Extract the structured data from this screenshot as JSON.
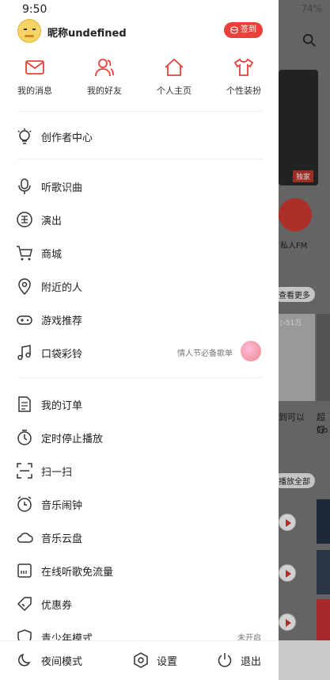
{
  "status": {
    "time": "9:50",
    "battery": "74%"
  },
  "user": {
    "nickname": "昵称undefined",
    "signin_label": "签到"
  },
  "quick_actions": [
    {
      "label": "我的消息",
      "icon": "mail-icon"
    },
    {
      "label": "我的好友",
      "icon": "friends-icon"
    },
    {
      "label": "个人主页",
      "icon": "home-icon"
    },
    {
      "label": "个性装扮",
      "icon": "shirt-icon"
    }
  ],
  "menu": {
    "creator": "创作者中心",
    "items": [
      {
        "label": "听歌识曲"
      },
      {
        "label": "演出"
      },
      {
        "label": "商城"
      },
      {
        "label": "附近的人"
      },
      {
        "label": "游戏推荐"
      },
      {
        "label": "口袋彩铃",
        "note": "情人节必备歌单"
      }
    ],
    "items2": [
      {
        "label": "我的订单"
      },
      {
        "label": "定时停止播放"
      },
      {
        "label": "扫一扫"
      },
      {
        "label": "音乐闹钟"
      },
      {
        "label": "音乐云盘"
      },
      {
        "label": "在线听歌免流量"
      },
      {
        "label": "优惠券"
      },
      {
        "label": "青少年模式",
        "note": "未开启"
      }
    ]
  },
  "footer": {
    "night_mode": "夜间模式",
    "settings": "设置",
    "logout": "退出"
  },
  "background": {
    "exclusive_tag": "独家",
    "fm_label": "私人FM",
    "see_more": "查看更多",
    "play_count": "▷51万",
    "song_text_1": "到可以",
    "song_text_2": "超好",
    "song_text_3": "Co",
    "play_all": "播放全部"
  },
  "colors": {
    "accent": "#e8403b"
  }
}
